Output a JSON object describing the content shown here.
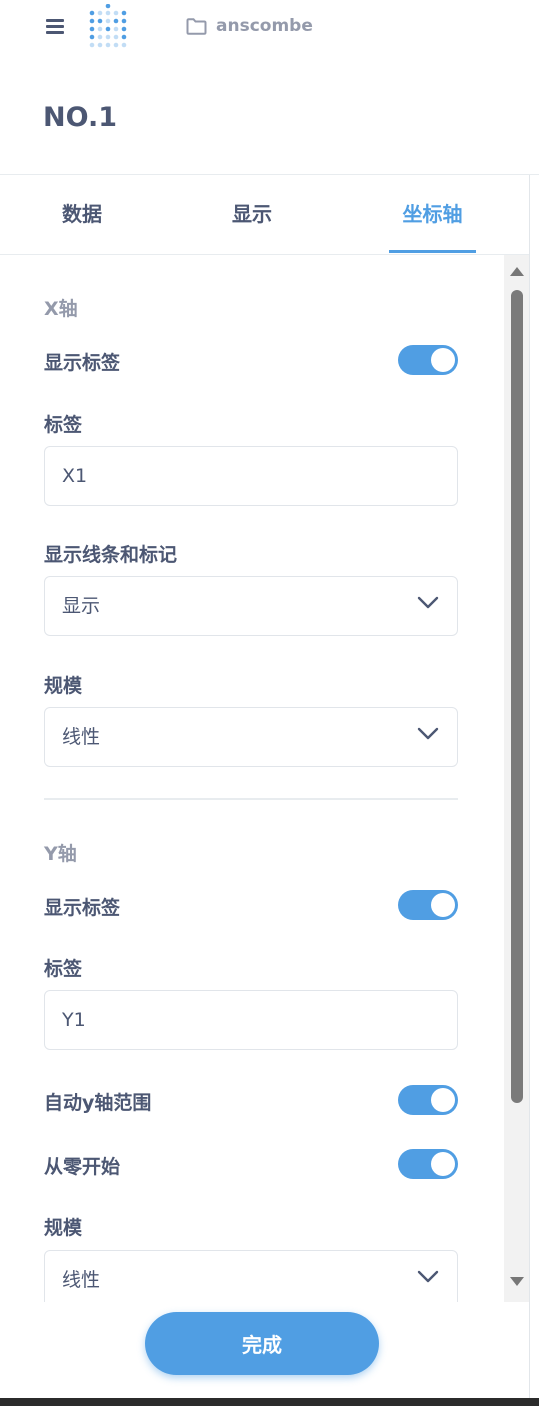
{
  "header": {
    "breadcrumb": "anscombe",
    "title": "NO.1"
  },
  "tabs": [
    {
      "label": "数据"
    },
    {
      "label": "显示"
    },
    {
      "label": "坐标轴",
      "active": true
    }
  ],
  "x_axis": {
    "section_title": "X轴",
    "show_label": {
      "label": "显示标签",
      "on": true
    },
    "label_field": {
      "label": "标签",
      "value": "X1"
    },
    "line_marks": {
      "label": "显示线条和标记",
      "value": "显示"
    },
    "scale": {
      "label": "规模",
      "value": "线性"
    }
  },
  "y_axis": {
    "section_title": "Y轴",
    "show_label": {
      "label": "显示标签",
      "on": true
    },
    "label_field": {
      "label": "标签",
      "value": "Y1"
    },
    "auto_range": {
      "label": "自动y轴范围",
      "on": true
    },
    "start_zero": {
      "label": "从零开始",
      "on": true
    },
    "scale": {
      "label": "规模",
      "value": "线性"
    }
  },
  "footer": {
    "done_label": "完成"
  },
  "colors": {
    "accent": "#509ee3",
    "text": "#4c5773",
    "muted": "#949aab"
  }
}
